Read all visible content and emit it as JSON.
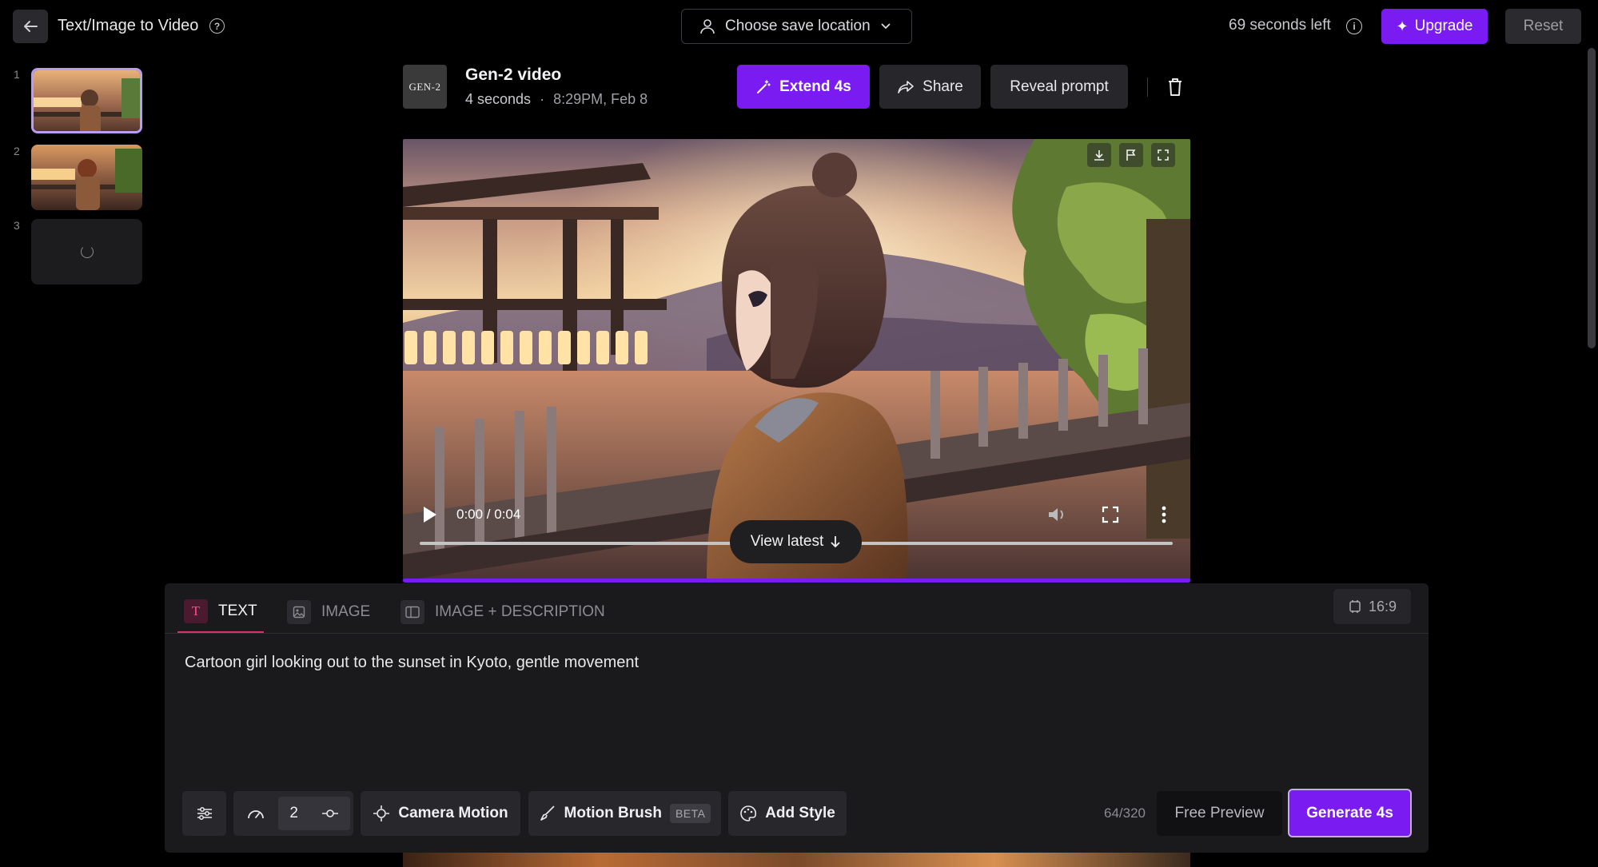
{
  "header": {
    "title": "Text/Image to Video",
    "save_location": "Choose save location",
    "seconds_left": "69 seconds left",
    "upgrade_label": "Upgrade",
    "reset_label": "Reset"
  },
  "thumbnails": [
    {
      "number": "1",
      "state": "selected"
    },
    {
      "number": "2",
      "state": "ready"
    },
    {
      "number": "3",
      "state": "loading"
    }
  ],
  "video": {
    "logo_text": "GEN-2",
    "title": "Gen-2 video",
    "duration": "4 seconds",
    "separator": "·",
    "timestamp": "8:29PM, Feb 8",
    "extend_label": "Extend 4s",
    "share_label": "Share",
    "reveal_label": "Reveal prompt",
    "time_display": "0:00 / 0:04",
    "view_latest_label": "View latest"
  },
  "prompt": {
    "tabs": [
      {
        "label": "TEXT",
        "active": true
      },
      {
        "label": "IMAGE",
        "active": false
      },
      {
        "label": "IMAGE + DESCRIPTION",
        "active": false
      }
    ],
    "aspect_ratio": "16:9",
    "text": "Cartoon girl looking out to the sunset in Kyoto, gentle movement",
    "char_count": "64/320"
  },
  "toolbar": {
    "speed_value": "2",
    "camera_motion_label": "Camera Motion",
    "motion_brush_label": "Motion Brush",
    "beta_label": "BETA",
    "add_style_label": "Add Style",
    "free_preview_label": "Free Preview",
    "generate_label": "Generate 4s"
  },
  "colors": {
    "accent": "#7a1bf2",
    "background": "#000000",
    "panel": "#1a1a1c",
    "text_tab_accent": "#d6336c"
  }
}
